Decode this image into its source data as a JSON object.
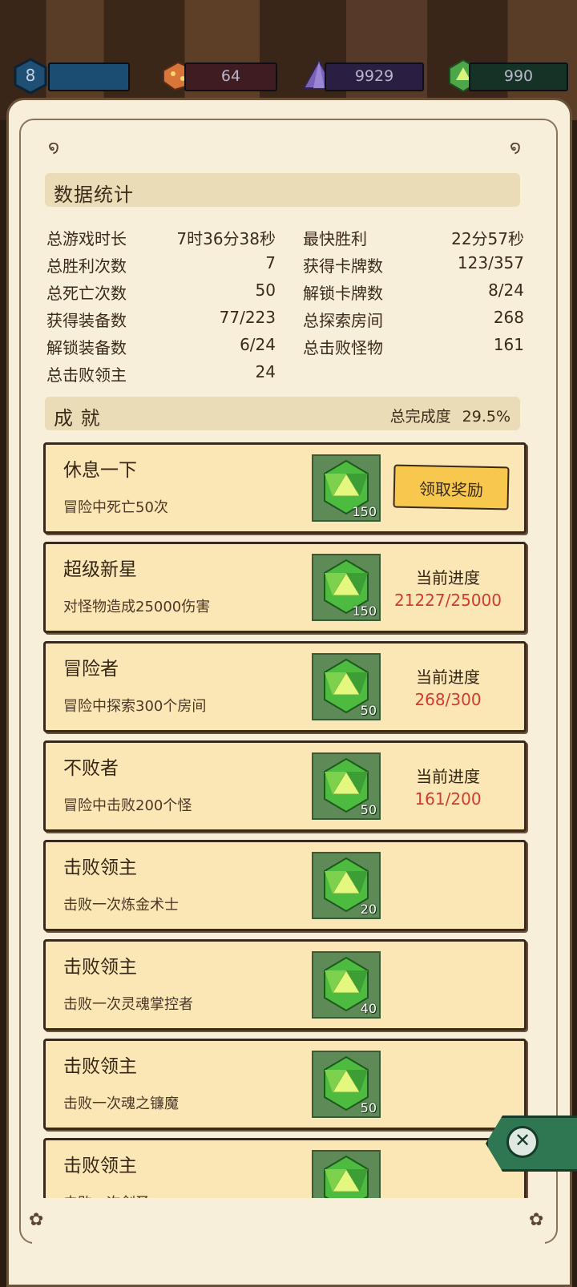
{
  "top": {
    "level": "8",
    "red_resource": "64",
    "purple_resource": "9929",
    "green_resource": "990"
  },
  "stats": {
    "title": "数据统计",
    "left": [
      {
        "label": "总游戏时长",
        "value": "7时36分38秒"
      },
      {
        "label": "总胜利次数",
        "value": "7"
      },
      {
        "label": "总死亡次数",
        "value": "50"
      },
      {
        "label": "获得装备数",
        "value": "77/223"
      },
      {
        "label": "解锁装备数",
        "value": "6/24"
      },
      {
        "label": "总击败领主",
        "value": "24"
      }
    ],
    "right": [
      {
        "label": "最快胜利",
        "value": "22分57秒"
      },
      {
        "label": "获得卡牌数",
        "value": "123/357"
      },
      {
        "label": "解锁卡牌数",
        "value": "8/24"
      },
      {
        "label": "总探索房间",
        "value": "268"
      },
      {
        "label": "总击败怪物",
        "value": "161"
      }
    ]
  },
  "achievements": {
    "title": "成 就",
    "completion_label": "总完成度",
    "completion_value": "29.5%",
    "claim_label": "领取奖励",
    "progress_label": "当前进度",
    "items": [
      {
        "title": "休息一下",
        "desc": "冒险中死亡50次",
        "reward": "150"
      },
      {
        "title": "超级新星",
        "desc": "对怪物造成25000伤害",
        "reward": "150",
        "progress": "21227/25000"
      },
      {
        "title": "冒险者",
        "desc": "冒险中探索300个房间",
        "reward": "50",
        "progress": "268/300"
      },
      {
        "title": "不败者",
        "desc": "冒险中击败200个怪",
        "reward": "50",
        "progress": "161/200"
      },
      {
        "title": "击败领主",
        "desc": "击败一次炼金术士",
        "reward": "20"
      },
      {
        "title": "击败领主",
        "desc": "击败一次灵魂掌控者",
        "reward": "40"
      },
      {
        "title": "击败领主",
        "desc": "击败一次魂之镰魔",
        "reward": "50"
      },
      {
        "title": "击败领主",
        "desc": "击败一次剑圣",
        "reward": ""
      }
    ]
  },
  "close_glyph": "✕",
  "colors": {
    "parchment": "#f7efd9",
    "card": "#fbe6b6",
    "progress": "#d33b2c",
    "claim": "#f7c84d"
  }
}
